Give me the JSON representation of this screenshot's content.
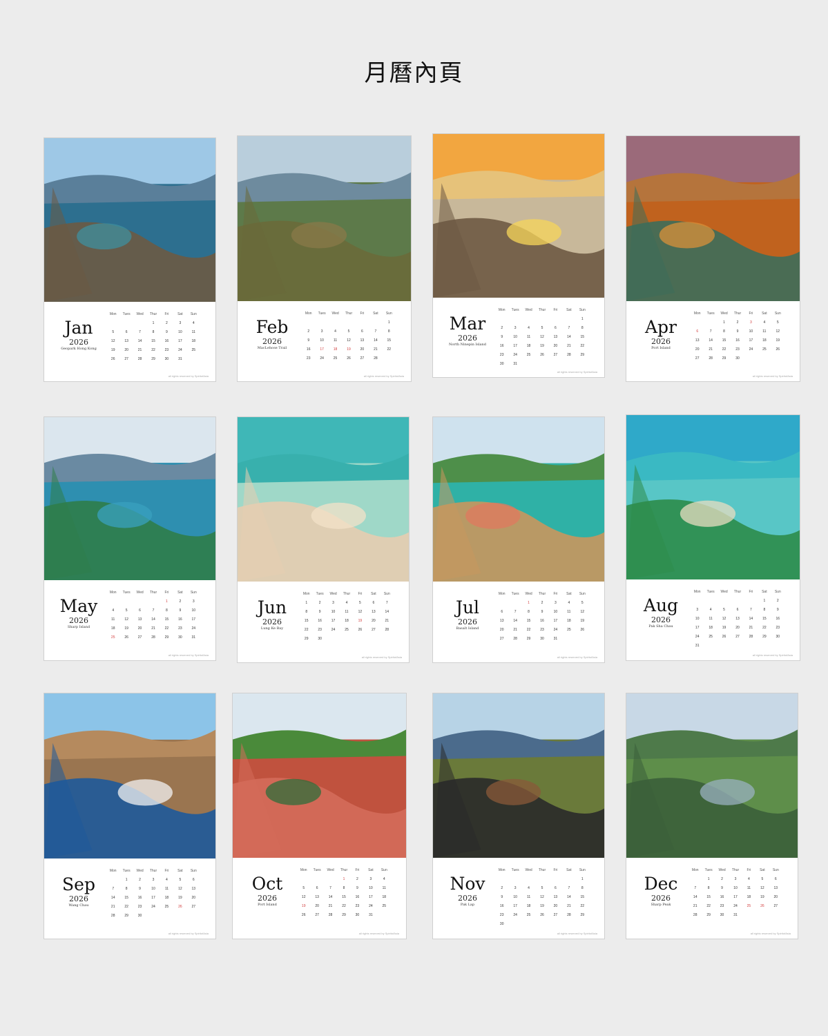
{
  "page": {
    "title": "月曆內頁"
  },
  "day_headers": [
    "Mon",
    "Tues",
    "Wed",
    "Thur",
    "Fri",
    "Sat",
    "Sun"
  ],
  "credit_text": "all rights reserved by SpiritofAsia",
  "months": [
    {
      "month": "Jan",
      "year": "2026",
      "location": "Geopark Hong Kong",
      "first_weekday": 4,
      "days": 31,
      "holidays": []
    },
    {
      "month": "Feb",
      "year": "2026",
      "location": "MacLehose Trail",
      "first_weekday": 7,
      "days": 28,
      "holidays": [
        17,
        18,
        19
      ]
    },
    {
      "month": "Mar",
      "year": "2026",
      "location": "North Ninepin Island",
      "first_weekday": 7,
      "days": 31,
      "holidays": []
    },
    {
      "month": "Apr",
      "year": "2026",
      "location": "Port Island",
      "first_weekday": 3,
      "days": 30,
      "holidays": [
        3,
        6
      ]
    },
    {
      "month": "May",
      "year": "2026",
      "location": "Sharp Island",
      "first_weekday": 5,
      "days": 31,
      "holidays": [
        1,
        25
      ]
    },
    {
      "month": "Jun",
      "year": "2026",
      "location": "Lung Ke Bay",
      "first_weekday": 1,
      "days": 30,
      "holidays": [
        19
      ]
    },
    {
      "month": "Jul",
      "year": "2026",
      "location": "Basalt Island",
      "first_weekday": 3,
      "days": 31,
      "holidays": [
        1
      ]
    },
    {
      "month": "Aug",
      "year": "2026",
      "location": "Pak Sha Chau",
      "first_weekday": 6,
      "days": 31,
      "holidays": []
    },
    {
      "month": "Sep",
      "year": "2026",
      "location": "Wang Chau",
      "first_weekday": 2,
      "days": 30,
      "holidays": [
        26
      ]
    },
    {
      "month": "Oct",
      "year": "2026",
      "location": "Port Island",
      "first_weekday": 4,
      "days": 31,
      "holidays": [
        1,
        19
      ]
    },
    {
      "month": "Nov",
      "year": "2026",
      "location": "Pak Lap",
      "first_weekday": 7,
      "days": 30,
      "holidays": []
    },
    {
      "month": "Dec",
      "year": "2026",
      "location": "Sharp Peak",
      "first_weekday": 2,
      "days": 31,
      "holidays": [
        25,
        26
      ]
    }
  ],
  "photo_colors": [
    {
      "sky": "#9ec8e6",
      "top": "#5a7f9a",
      "mid": "#2d6f8f",
      "bot": "#6b5a44",
      "accent": "#3f8f9e"
    },
    {
      "sky": "#b9cedc",
      "top": "#6e8b9e",
      "mid": "#5d7a4a",
      "bot": "#6a6a3a",
      "accent": "#8a7a4a"
    },
    {
      "sky": "#f2a640",
      "top": "#e6c27a",
      "mid": "#c8b89a",
      "bot": "#6e5a44",
      "accent": "#f7d65a"
    },
    {
      "sky": "#9b6a7a",
      "top": "#b5743c",
      "mid": "#c0621e",
      "bot": "#3d6e5a",
      "accent": "#d9903a"
    },
    {
      "sky": "#dbe6ee",
      "top": "#6a8aa2",
      "mid": "#2e8fb0",
      "bot": "#2f7d4a",
      "accent": "#3aa0bf"
    },
    {
      "sky": "#3fb7b7",
      "top": "#38b0ad",
      "mid": "#9fd8c8",
      "bot": "#e6cdb0",
      "accent": "#f3e1c8"
    },
    {
      "sky": "#cfe2ee",
      "top": "#4e8f4a",
      "mid": "#2fb1a6",
      "bot": "#c9975e",
      "accent": "#e07a5f"
    },
    {
      "sky": "#2fa9c9",
      "top": "#3ab9c3",
      "mid": "#58c6c6",
      "bot": "#2d8c4a",
      "accent": "#e8dcc0"
    },
    {
      "sky": "#8cc4e8",
      "top": "#b58a5e",
      "mid": "#9a7550",
      "bot": "#1e5a9a",
      "accent": "#f2f2f2"
    },
    {
      "sky": "#dbe7ef",
      "top": "#4a8a3a",
      "mid": "#c0523e",
      "bot": "#d46b5a",
      "accent": "#2e6e3a"
    },
    {
      "sky": "#b7d3e6",
      "top": "#4b6b8c",
      "mid": "#6a7a3a",
      "bot": "#2a2a2a",
      "accent": "#8a5a3a"
    },
    {
      "sky": "#c8d8e6",
      "top": "#4e7a4a",
      "mid": "#5e8e4a",
      "bot": "#3b5f3a",
      "accent": "#9ab0c0"
    }
  ]
}
